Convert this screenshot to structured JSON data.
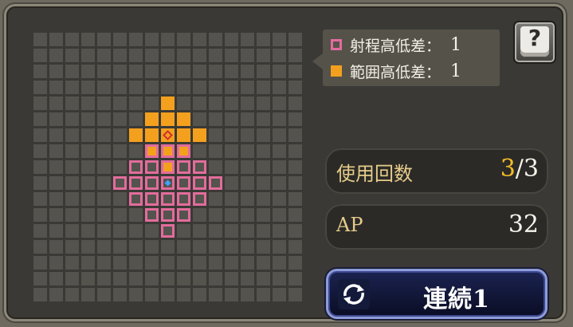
{
  "legend": {
    "range_label": "射程高低差：",
    "range_value": "1",
    "area_label": "範囲高低差：",
    "area_value": "1"
  },
  "help": {
    "icon": "help-book-icon",
    "glyph": "?"
  },
  "uses": {
    "label": "使用回数",
    "current": "3",
    "separator": "/",
    "max": "3"
  },
  "ap": {
    "label": "AP",
    "value": "32"
  },
  "combo": {
    "label": "連続1",
    "icon": "cycle-arrows-icon"
  },
  "colors": {
    "range": "#e26c9c",
    "area": "#f3a01e",
    "target": "#d03030",
    "unit": "#3fa0ff",
    "empty_cell": "#55534d"
  },
  "grid": {
    "cols": 17,
    "rows": 17,
    "cells": [
      {
        "c": 8,
        "r": 4,
        "type": "area"
      },
      {
        "c": 7,
        "r": 5,
        "type": "area"
      },
      {
        "c": 8,
        "r": 5,
        "type": "area"
      },
      {
        "c": 9,
        "r": 5,
        "type": "area"
      },
      {
        "c": 6,
        "r": 6,
        "type": "area"
      },
      {
        "c": 7,
        "r": 6,
        "type": "area"
      },
      {
        "c": 8,
        "r": 6,
        "type": "target"
      },
      {
        "c": 9,
        "r": 6,
        "type": "area"
      },
      {
        "c": 10,
        "r": 6,
        "type": "area"
      },
      {
        "c": 7,
        "r": 7,
        "type": "range-area"
      },
      {
        "c": 8,
        "r": 7,
        "type": "range-area"
      },
      {
        "c": 9,
        "r": 7,
        "type": "range-area"
      },
      {
        "c": 6,
        "r": 8,
        "type": "range"
      },
      {
        "c": 7,
        "r": 8,
        "type": "range"
      },
      {
        "c": 8,
        "r": 8,
        "type": "range-area"
      },
      {
        "c": 9,
        "r": 8,
        "type": "range"
      },
      {
        "c": 10,
        "r": 8,
        "type": "range"
      },
      {
        "c": 5,
        "r": 9,
        "type": "range"
      },
      {
        "c": 6,
        "r": 9,
        "type": "range"
      },
      {
        "c": 7,
        "r": 9,
        "type": "range"
      },
      {
        "c": 8,
        "r": 9,
        "type": "unit"
      },
      {
        "c": 9,
        "r": 9,
        "type": "range"
      },
      {
        "c": 10,
        "r": 9,
        "type": "range"
      },
      {
        "c": 11,
        "r": 9,
        "type": "range"
      },
      {
        "c": 6,
        "r": 10,
        "type": "range"
      },
      {
        "c": 7,
        "r": 10,
        "type": "range"
      },
      {
        "c": 8,
        "r": 10,
        "type": "range"
      },
      {
        "c": 9,
        "r": 10,
        "type": "range"
      },
      {
        "c": 10,
        "r": 10,
        "type": "range"
      },
      {
        "c": 7,
        "r": 11,
        "type": "range"
      },
      {
        "c": 8,
        "r": 11,
        "type": "range"
      },
      {
        "c": 9,
        "r": 11,
        "type": "range"
      },
      {
        "c": 8,
        "r": 12,
        "type": "range"
      }
    ]
  }
}
